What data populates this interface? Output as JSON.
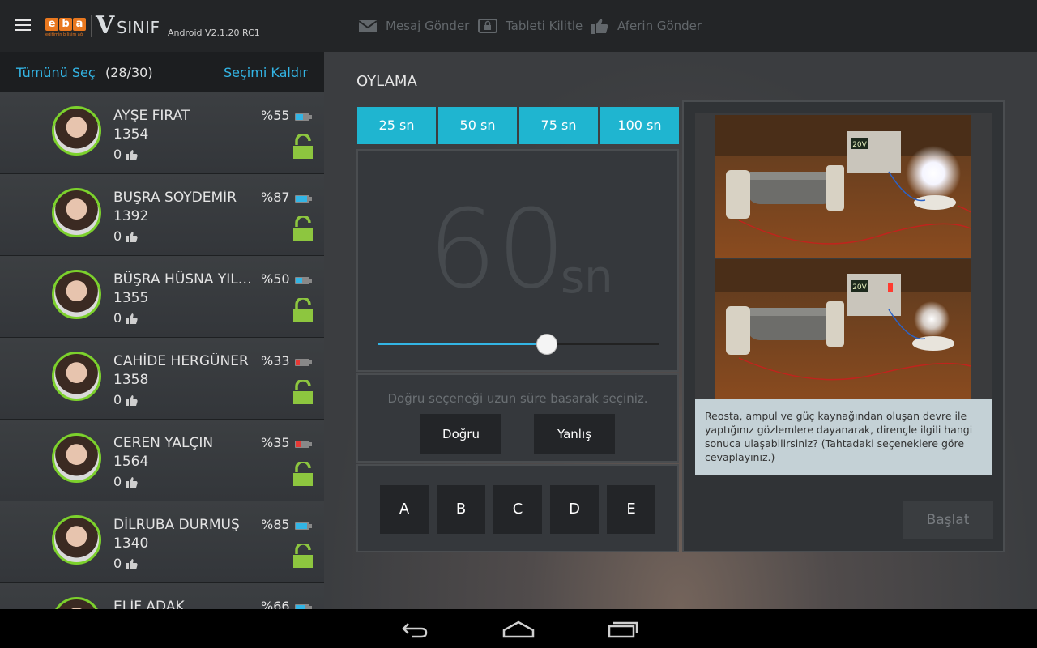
{
  "topbar": {
    "logo_letters": [
      "e",
      "b",
      "a"
    ],
    "logo_tagline": "eğitimin bilişim ağı",
    "logo_v": "V",
    "logo_word": "SINIF",
    "version": "Android V2.1.20 RC1",
    "actions": [
      {
        "label": "Mesaj Gönder",
        "icon": "envelope-icon"
      },
      {
        "label": "Tableti Kilitle",
        "icon": "tablet-lock-icon"
      },
      {
        "label": "Aferin Gönder",
        "icon": "thumbs-up-icon"
      }
    ]
  },
  "sidebar": {
    "select_all": "Tümünü Seç",
    "count": "(28/30)",
    "clear": "Seçimi Kaldır",
    "students": [
      {
        "name": "AYŞE FIRAT",
        "number": "1354",
        "likes": "0",
        "battery": "%55",
        "battery_level": 0.55,
        "battery_color": "#33b5e5"
      },
      {
        "name": "BÜŞRA SOYDEMİR",
        "number": "1392",
        "likes": "0",
        "battery": "%87",
        "battery_level": 0.87,
        "battery_color": "#33b5e5"
      },
      {
        "name": "BÜŞRA HÜSNA YILDIZ",
        "number": "1355",
        "likes": "0",
        "battery": "%50",
        "battery_level": 0.5,
        "battery_color": "#33b5e5"
      },
      {
        "name": "CAHİDE HERGÜNER",
        "number": "1358",
        "likes": "0",
        "battery": "%33",
        "battery_level": 0.33,
        "battery_color": "#e53935"
      },
      {
        "name": "CEREN YALÇIN",
        "number": "1564",
        "likes": "0",
        "battery": "%35",
        "battery_level": 0.35,
        "battery_color": "#e53935"
      },
      {
        "name": "DİLRUBA DURMUŞ",
        "number": "1340",
        "likes": "0",
        "battery": "%85",
        "battery_level": 0.85,
        "battery_color": "#33b5e5"
      },
      {
        "name": "ELİF ADAK",
        "number": "",
        "likes": "",
        "battery": "%66",
        "battery_level": 0.66,
        "battery_color": "#33b5e5"
      }
    ]
  },
  "main": {
    "title": "OYLAMA",
    "time_buttons": [
      "25 sn",
      "50 sn",
      "75 sn",
      "100 sn"
    ],
    "timer_value": "60",
    "timer_unit": "sn",
    "slider_fraction": 0.6,
    "hint": "Doğru seçeneği uzun süre basarak seçiniz.",
    "true_label": "Doğru",
    "false_label": "Yanlış",
    "options": [
      "A",
      "B",
      "C",
      "D",
      "E"
    ],
    "image_top_voltage": "20V",
    "image_bottom_voltage": "20V",
    "question": "Reosta, ampul ve güç kaynağından oluşan devre ile yaptığınız gözlemlere dayanarak, dirençle ilgili hangi sonuca ulaşabilirsiniz? (Tahtadaki seçeneklere göre cevaplayınız.)",
    "start_label": "Başlat"
  },
  "colors": {
    "accent": "#33b5e5",
    "button_cyan": "#1fb5d0",
    "avatar_ring": "#7cd12c",
    "lock": "#8dc63f"
  }
}
